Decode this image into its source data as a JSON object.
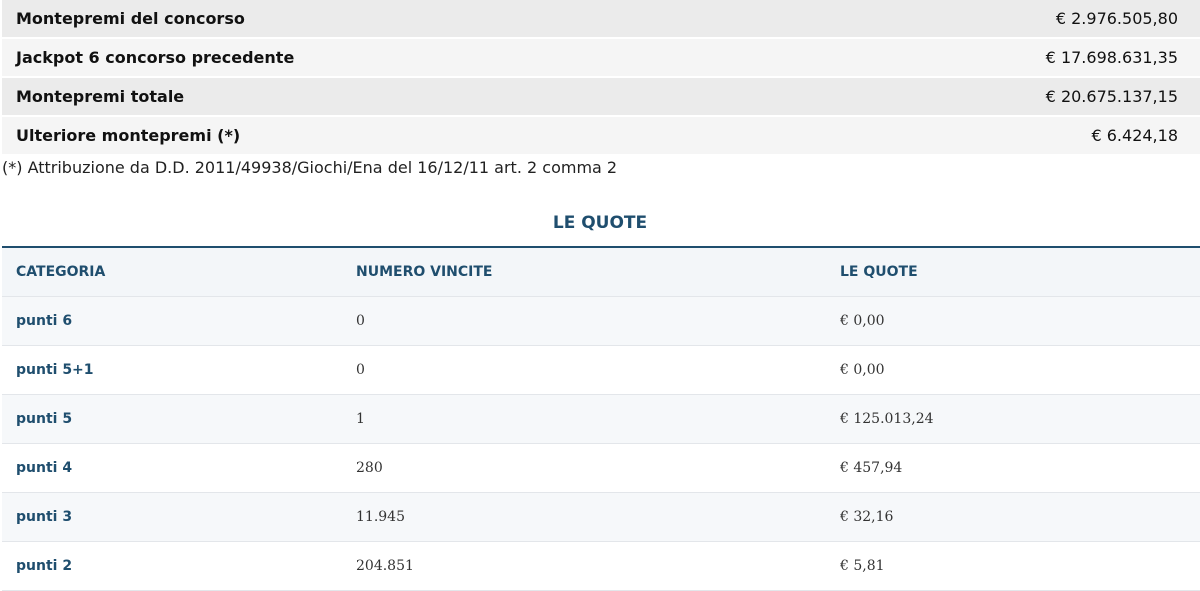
{
  "summary": [
    {
      "label": "Montepremi del concorso",
      "value": "€ 2.976.505,80"
    },
    {
      "label": "Jackpot 6 concorso precedente",
      "value": "€ 17.698.631,35"
    },
    {
      "label": "Montepremi totale",
      "value": "€ 20.675.137,15"
    },
    {
      "label": "Ulteriore montepremi (*)",
      "value": "€ 6.424,18"
    }
  ],
  "note": "(*) Attribuzione da D.D. 2011/49938/Giochi/Ena del 16/12/11 art. 2 comma 2",
  "quote": {
    "title": "LE QUOTE",
    "headers": [
      "CATEGORIA",
      "NUMERO VINCITE",
      "LE QUOTE"
    ],
    "rows": [
      {
        "categoria": "punti 6",
        "vincite": "0",
        "quota": "€ 0,00"
      },
      {
        "categoria": "punti 5+1",
        "vincite": "0",
        "quota": "€ 0,00"
      },
      {
        "categoria": "punti 5",
        "vincite": "1",
        "quota": "€ 125.013,24"
      },
      {
        "categoria": "punti 4",
        "vincite": "280",
        "quota": "€ 457,94"
      },
      {
        "categoria": "punti 3",
        "vincite": "11.945",
        "quota": "€ 32,16"
      },
      {
        "categoria": "punti 2",
        "vincite": "204.851",
        "quota": "€ 5,81"
      }
    ]
  },
  "colors": {
    "accent": "#1f4e6e"
  }
}
